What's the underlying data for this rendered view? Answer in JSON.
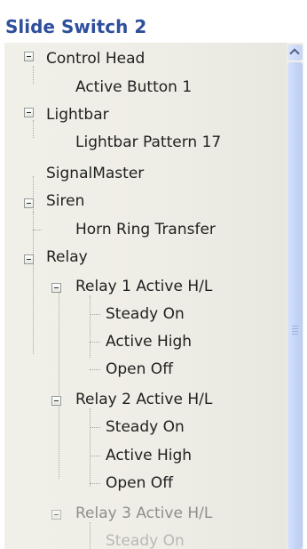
{
  "title": "Slide Switch 2",
  "tree": {
    "control_head": "Control Head",
    "active_button_1": "Active Button 1",
    "lightbar": "Lightbar",
    "lightbar_pattern_17": "Lightbar Pattern 17",
    "signalmaster": "SignalMaster",
    "siren": "Siren",
    "horn_ring_transfer": "Horn Ring Transfer",
    "relay": "Relay",
    "relay1": {
      "label": "Relay 1 Active H/L",
      "children": [
        "Steady On",
        "Active High",
        "Open Off"
      ]
    },
    "relay2": {
      "label": "Relay 2 Active H/L",
      "children": [
        "Steady On",
        "Active High",
        "Open Off"
      ]
    },
    "relay3": {
      "label": "Relay 3 Active H/L",
      "children": [
        "Steady On"
      ]
    }
  },
  "icons": {
    "expander": "minus-box-icon",
    "scroll_up": "chevron-up-icon"
  },
  "colors": {
    "title": "#2e4f9c",
    "panel_background": "#efeee6",
    "scrollbar": "#c6d4f4"
  }
}
